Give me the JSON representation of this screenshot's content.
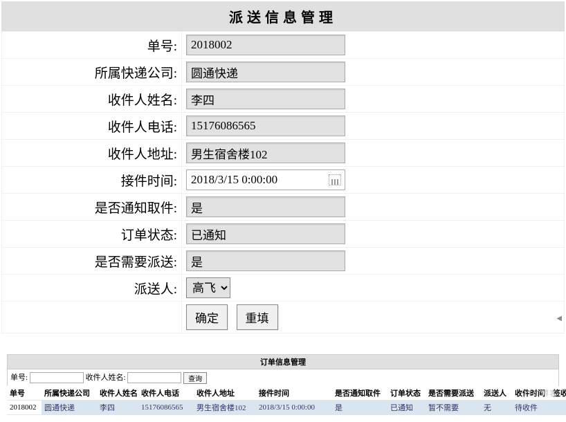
{
  "form": {
    "title": "派送信息管理",
    "fields": {
      "order_no": {
        "label": "单号:",
        "value": "2018002"
      },
      "company": {
        "label": "所属快递公司:",
        "value": "圆通快递"
      },
      "recipient_name": {
        "label": "收件人姓名:",
        "value": "李四"
      },
      "recipient_phone": {
        "label": "收件人电话:",
        "value": "15176086565"
      },
      "recipient_addr": {
        "label": "收件人地址:",
        "value": "男生宿舍楼102"
      },
      "receive_time": {
        "label": "接件时间:",
        "value": "2018/3/15 0:00:00"
      },
      "notified": {
        "label": "是否通知取件:",
        "value": "是"
      },
      "order_status": {
        "label": "订单状态:",
        "value": "已通知"
      },
      "need_delivery": {
        "label": "是否需要派送:",
        "value": "是"
      },
      "courier": {
        "label": "派送人:",
        "selected": "高飞",
        "options": [
          "高飞"
        ]
      }
    },
    "buttons": {
      "submit": "确定",
      "reset": "重填"
    }
  },
  "list": {
    "title": "订单信息管理",
    "search": {
      "order_no_label": "单号:",
      "name_label": "收件人姓名:",
      "query_btn": "查询"
    },
    "columns": [
      "单号",
      "所属快递公司",
      "收件人姓名",
      "收件人电话",
      "收件人地址",
      "接件时间",
      "是否通知取件",
      "订单状态",
      "是否需要派送",
      "派送人",
      "收件时间",
      "签收"
    ],
    "col_widths": [
      "50",
      "80",
      "60",
      "80",
      "90",
      "110",
      "80",
      "55",
      "80",
      "45",
      "55",
      "40"
    ],
    "rows": [
      {
        "cells": [
          "2018002",
          "圆通快递",
          "李四",
          "15176086565",
          "男生宿舍楼102",
          "2018/3/15 0:00:00",
          "是",
          "已通知",
          "暂不需要",
          "无",
          "待收件",
          ""
        ]
      }
    ]
  },
  "watermark": "ITC 博客"
}
